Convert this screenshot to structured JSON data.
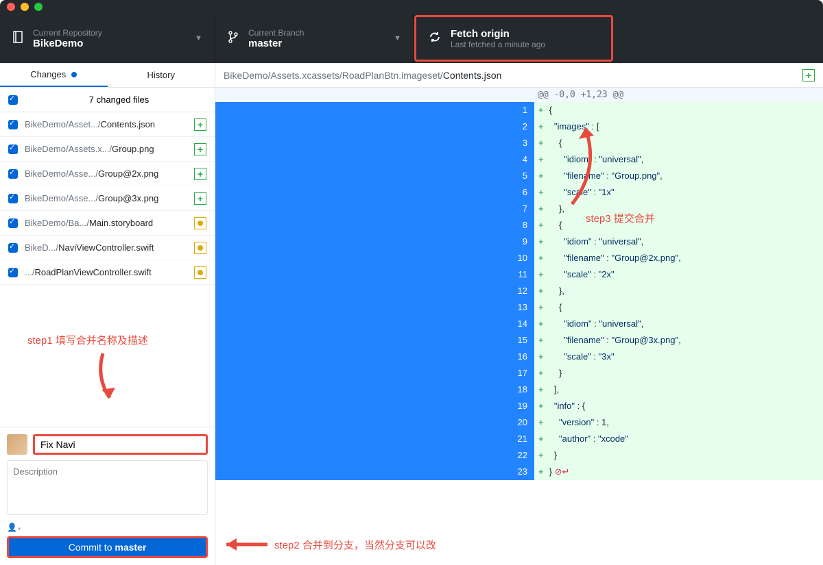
{
  "toolbar": {
    "repo_label": "Current Repository",
    "repo_value": "BikeDemo",
    "branch_label": "Current Branch",
    "branch_value": "master",
    "fetch_label": "Fetch origin",
    "fetch_value": "Last fetched a minute ago"
  },
  "tabs": {
    "changes": "Changes",
    "history": "History"
  },
  "files_header": "7 changed files",
  "files": [
    {
      "prefix": "BikeDemo/Asset.../",
      "name": "Contents.json",
      "status": "add"
    },
    {
      "prefix": "BikeDemo/Assets.x.../",
      "name": "Group.png",
      "status": "add"
    },
    {
      "prefix": "BikeDemo/Asse.../",
      "name": "Group@2x.png",
      "status": "add"
    },
    {
      "prefix": "BikeDemo/Asse.../",
      "name": "Group@3x.png",
      "status": "add"
    },
    {
      "prefix": "BikeDemo/Ba.../",
      "name": "Main.storyboard",
      "status": "mod"
    },
    {
      "prefix": "BikeD.../",
      "name": "NaviViewController.swift",
      "status": "mod"
    },
    {
      "prefix": ".../",
      "name": "RoadPlanViewController.swift",
      "status": "mod"
    }
  ],
  "annotations": {
    "step1": "step1 填写合并名称及描述",
    "step2": "step2 合并到分支，当然分支可以改",
    "step3": "step3 提交合并"
  },
  "commit": {
    "summary_value": "Fix Navi",
    "desc_placeholder": "Description",
    "coauthor": "⊕",
    "button_prefix": "Commit to ",
    "button_branch": "master"
  },
  "path": {
    "prefix": "BikeDemo/Assets.xcassets/RoadPlanBtn.imageset/",
    "name": "Contents.json"
  },
  "diff": {
    "hunk": "@@ -0,0 +1,23 @@",
    "lines": [
      "{",
      "  \"images\" : [",
      "    {",
      "      \"idiom\" : \"universal\",",
      "      \"filename\" : \"Group.png\",",
      "      \"scale\" : \"1x\"",
      "    },",
      "    {",
      "      \"idiom\" : \"universal\",",
      "      \"filename\" : \"Group@2x.png\",",
      "      \"scale\" : \"2x\"",
      "    },",
      "    {",
      "      \"idiom\" : \"universal\",",
      "      \"filename\" : \"Group@3x.png\",",
      "      \"scale\" : \"3x\"",
      "    }",
      "  ],",
      "  \"info\" : {",
      "    \"version\" : 1,",
      "    \"author\" : \"xcode\"",
      "  }",
      "}"
    ]
  }
}
